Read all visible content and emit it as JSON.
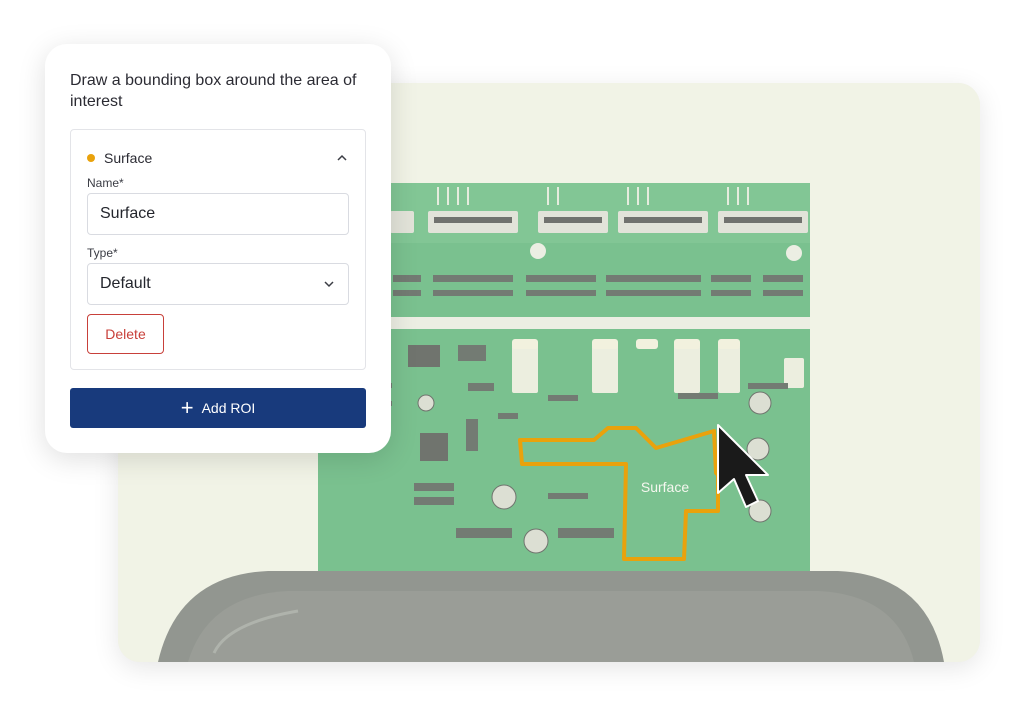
{
  "panel": {
    "title": "Draw a bounding box around the area of interest",
    "roi": {
      "name": "Surface",
      "dot_color": "#e9a20c",
      "expanded_icon": "chevron-up-icon",
      "name_label": "Name*",
      "name_value": "Surface",
      "type_label": "Type*",
      "type_value": "Default",
      "type_icon": "chevron-down-icon",
      "delete_label": "Delete"
    },
    "add_button": {
      "icon": "plus-icon",
      "label": "Add ROI"
    }
  },
  "canvas": {
    "roi_label": "Surface",
    "roi_color": "#e9a20c",
    "cursor_icon": "mouse-pointer-icon"
  },
  "colors": {
    "primary": "#183a7c",
    "danger": "#c8403a",
    "pcb_green": "#3aa55e"
  }
}
